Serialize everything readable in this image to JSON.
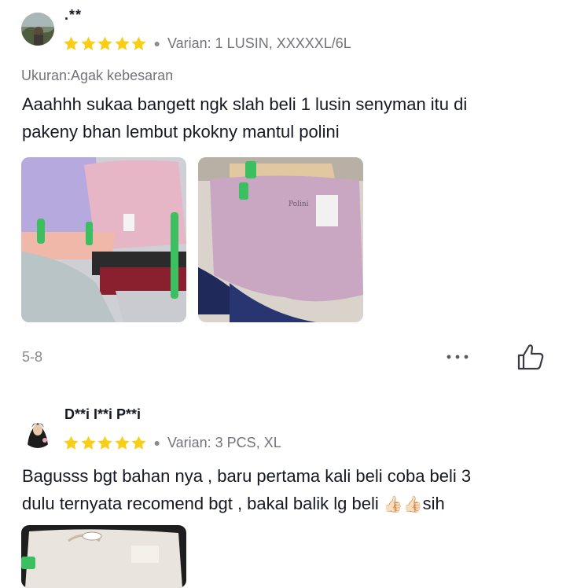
{
  "reviews": [
    {
      "username": ".**",
      "rating": 5,
      "variant": "Varian: 1 LUSIN, XXXXXL/6L",
      "size_note": "Ukuran:Agak kebesaran",
      "text_line1": "Aaahhh sukaa bangett ngk slah beli 1 lusin senyman itu di",
      "text_line2": "pakeny bhan lembut pkokny mantul polini",
      "date": "5-8",
      "photos": 2
    },
    {
      "username": "D**i I**i P**i",
      "rating": 5,
      "variant": "Varian: 3 PCS, XL",
      "text_line1": "Bagusss bgt bahan nya , baru pertama kali beli coba beli 3",
      "text_line2_prefix": "dulu ternyata recomend bgt , bakal balik lg beli ",
      "emoji": "👍🏻👍🏻",
      "text_line2_suffix": "sih",
      "photos": 1
    }
  ],
  "colors": {
    "star": "#FACE15",
    "text_primary": "#161823",
    "text_secondary": "#73747a"
  },
  "icons": {
    "more": "more-dots-icon",
    "like": "thumbs-up-icon"
  }
}
